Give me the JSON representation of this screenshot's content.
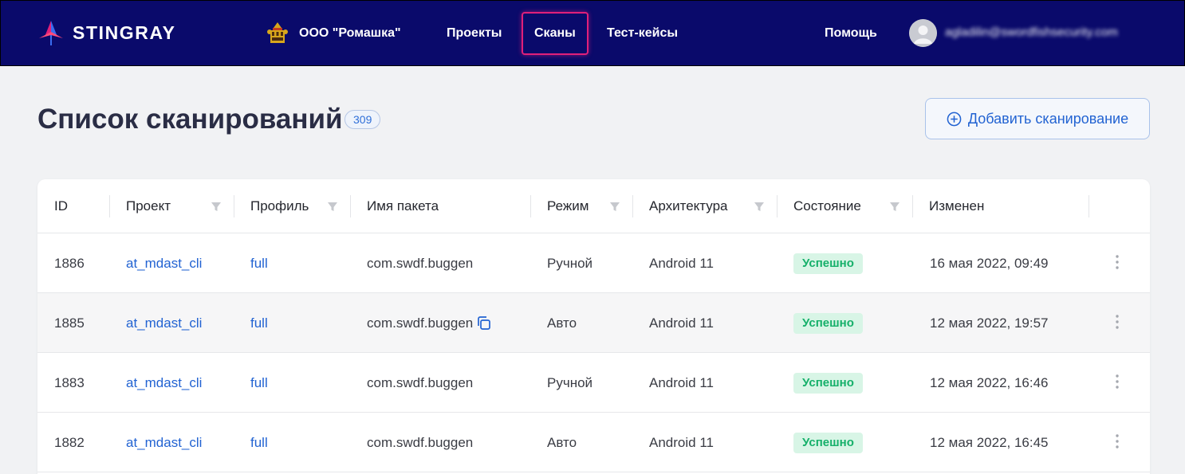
{
  "brand": {
    "name": "STINGRAY"
  },
  "org": {
    "name": "ООО \"Ромашка\""
  },
  "nav": {
    "projects": "Проекты",
    "scans": "Сканы",
    "testcases": "Тест-кейсы",
    "help": "Помощь"
  },
  "user": {
    "email": "agladilin@swordfishsecurity.com"
  },
  "page": {
    "title": "Список сканирований",
    "count": "309",
    "add_button": "Добавить сканирование"
  },
  "table": {
    "columns": {
      "id": "ID",
      "project": "Проект",
      "profile": "Профиль",
      "package": "Имя пакета",
      "mode": "Режим",
      "arch": "Архитектура",
      "state": "Состояние",
      "changed": "Изменен"
    },
    "rows": [
      {
        "id": "1886",
        "project": "at_mdast_cli",
        "profile": "full",
        "package": "com.swdf.buggen",
        "mode": "Ручной",
        "arch": "Android 11",
        "state": "Успешно",
        "changed": "16 мая 2022, 09:49"
      },
      {
        "id": "1885",
        "project": "at_mdast_cli",
        "profile": "full",
        "package": "com.swdf.buggen",
        "mode": "Авто",
        "arch": "Android 11",
        "state": "Успешно",
        "changed": "12 мая 2022, 19:57"
      },
      {
        "id": "1883",
        "project": "at_mdast_cli",
        "profile": "full",
        "package": "com.swdf.buggen",
        "mode": "Ручной",
        "arch": "Android 11",
        "state": "Успешно",
        "changed": "12 мая 2022, 16:46"
      },
      {
        "id": "1882",
        "project": "at_mdast_cli",
        "profile": "full",
        "package": "com.swdf.buggen",
        "mode": "Авто",
        "arch": "Android 11",
        "state": "Успешно",
        "changed": "12 мая 2022, 16:45"
      }
    ]
  },
  "colors": {
    "topbar": "#0a0a6b",
    "accent_link": "#2263d2",
    "active_nav_border": "#e0207a",
    "status_success_bg": "#d8f5e6",
    "status_success_text": "#16b06a"
  },
  "icons": {
    "logo": "stingray-logo-icon",
    "org": "org-crest-icon",
    "avatar": "user-avatar-icon",
    "add": "plus-circle-icon",
    "filter": "filter-icon",
    "copy": "copy-icon",
    "row_menu": "kebab-menu-icon"
  }
}
